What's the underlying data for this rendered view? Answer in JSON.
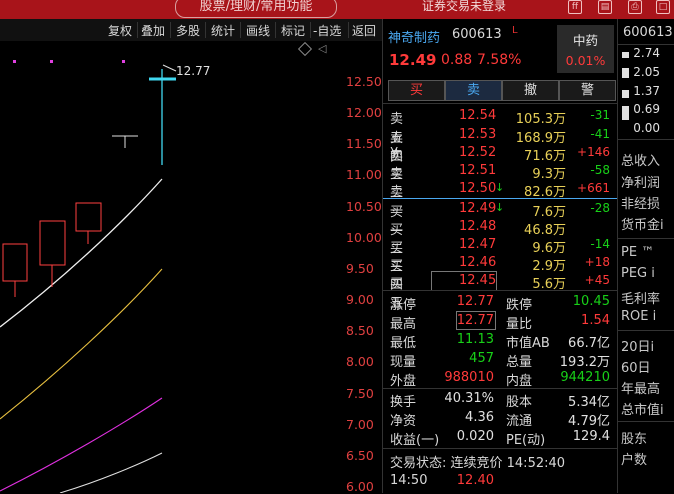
{
  "topbar": {
    "search_placeholder": "股票/理财/常用功能",
    "trade_status": "证券交易未登录",
    "icons": [
      "ff-icon",
      "stats-icon",
      "print-icon",
      "window-icon"
    ]
  },
  "toolbar": {
    "buttons": [
      "复权",
      "叠加",
      "多股",
      "统计",
      "画线",
      "标记",
      "-自选",
      "返回"
    ]
  },
  "chart": {
    "high_label": "12.77",
    "price_axis": [
      "12.50",
      "12.00",
      "11.50",
      "11.00",
      "10.50",
      "10.00",
      "9.50",
      "9.00",
      "8.50",
      "8.00",
      "7.50",
      "7.00",
      "6.50",
      "6.00"
    ]
  },
  "quote": {
    "name": "神奇制药",
    "code": "600613",
    "mark": "L",
    "price": "12.49",
    "change": "0.88",
    "change_pct": "7.58%",
    "sector": "中药",
    "sector_pct": "0.01%"
  },
  "trade_buttons": [
    "买",
    "卖",
    "撤",
    "警"
  ],
  "order_book": {
    "asks": [
      {
        "label": "卖五 ¥",
        "price": "12.54",
        "vol": "105.3万",
        "chg": "-31"
      },
      {
        "label": "卖四",
        "price": "12.53",
        "vol": "168.9万",
        "chg": "-41"
      },
      {
        "label": "卖三",
        "price": "12.52",
        "vol": "71.6万",
        "chg": "+146"
      },
      {
        "label": "卖二",
        "price": "12.51",
        "vol": "9.3万",
        "chg": "-58"
      },
      {
        "label": "卖一",
        "price": "12.50",
        "vol": "82.6万",
        "chg": "+661"
      }
    ],
    "bids": [
      {
        "label": "买一",
        "price": "12.49",
        "vol": "7.6万",
        "chg": "-28"
      },
      {
        "label": "买二",
        "price": "12.48",
        "vol": "46.8万",
        "chg": ""
      },
      {
        "label": "买三",
        "price": "12.47",
        "vol": "9.6万",
        "chg": "-14"
      },
      {
        "label": "买四",
        "price": "12.46",
        "vol": "2.9万",
        "chg": "+18"
      },
      {
        "label": "买五",
        "price": "12.45",
        "vol": "5.6万",
        "chg": "+45"
      }
    ]
  },
  "stats": {
    "zhangting_l": "涨停",
    "zhangting_v": "12.77",
    "dieting_l": "跌停",
    "dieting_v": "10.45",
    "zuigao_l": "最高",
    "zuigao_v": "12.77",
    "liangbi_l": "量比",
    "liangbi_v": "1.54",
    "zuidi_l": "最低",
    "zuidi_v": "11.13",
    "shizhi_l": "市值AB",
    "shizhi_v": "66.7亿",
    "xianliang_l": "现量",
    "xianliang_v": "457",
    "zongliang_l": "总量",
    "zongliang_v": "193.2万",
    "waipan_l": "外盘",
    "waipan_v": "988010",
    "neipan_l": "内盘",
    "neipan_v": "944210",
    "huanshou_l": "换手",
    "huanshou_v": "40.31%",
    "guben_l": "股本",
    "guben_v": "5.34亿",
    "jingzi_l": "净资",
    "jingzi_v": "4.36",
    "liutong_l": "流通",
    "liutong_v": "4.79亿",
    "shouyi_l": "收益(一)",
    "shouyi_v": "0.020",
    "pe_l": "PE(动)",
    "pe_v": "129.4"
  },
  "status": {
    "text": "交易状态: 连续竞价 14:52:40",
    "tick_time": "14:50",
    "tick_price": "12.40"
  },
  "far_right": {
    "code": "600613",
    "nums": [
      "2.74",
      "2.05",
      "1.37",
      "0.69",
      "0.00"
    ],
    "labels": [
      "总收入",
      "净利润",
      "非经损",
      "货币金i",
      "PE ™",
      "PEG i",
      "毛利率",
      "ROE i",
      "20日i",
      "60日",
      "年最高",
      "总市值i",
      "股东",
      "户数"
    ]
  },
  "colors": {
    "up": "#ff3a3a",
    "down": "#18d018",
    "volume": "#e8d058",
    "brand_bar": "#a8141a",
    "name": "#4aa8f0"
  }
}
